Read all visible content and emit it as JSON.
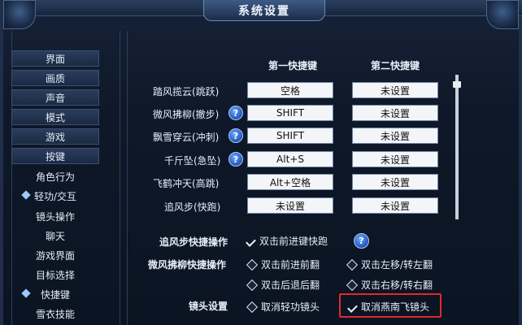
{
  "window": {
    "title": "系统设置"
  },
  "sidebar": {
    "items": [
      {
        "label": "界面",
        "boxed": true,
        "selected": false
      },
      {
        "label": "画质",
        "boxed": true,
        "selected": false
      },
      {
        "label": "声音",
        "boxed": true,
        "selected": false
      },
      {
        "label": "模式",
        "boxed": true,
        "selected": false
      },
      {
        "label": "游戏",
        "boxed": true,
        "selected": false
      },
      {
        "label": "按键",
        "boxed": true,
        "selected": false
      },
      {
        "label": "角色行为",
        "boxed": false,
        "selected": false
      },
      {
        "label": "轻功/交互",
        "boxed": false,
        "selected": true
      },
      {
        "label": "镜头操作",
        "boxed": false,
        "selected": false
      },
      {
        "label": "聊天",
        "boxed": false,
        "selected": false
      },
      {
        "label": "游戏界面",
        "boxed": false,
        "selected": false
      },
      {
        "label": "目标选择",
        "boxed": false,
        "selected": false
      },
      {
        "label": "快捷键",
        "boxed": false,
        "selected": true
      },
      {
        "label": "雪衣技能",
        "boxed": false,
        "selected": false
      }
    ]
  },
  "shortcuts": {
    "col1_header": "第一快捷键",
    "col2_header": "第二快捷键",
    "help_icon_text": "?",
    "rows": [
      {
        "label": "踏风揽云(跳跃)",
        "has_help": false,
        "key1": "空格",
        "key2": "未设置"
      },
      {
        "label": "微风拂柳(撤步)",
        "has_help": true,
        "key1": "SHIFT",
        "key2": "未设置"
      },
      {
        "label": "飘雪穿云(冲刺)",
        "has_help": true,
        "key1": "SHIFT",
        "key2": "未设置"
      },
      {
        "label": "千斤坠(急坠)",
        "has_help": true,
        "key1": "Alt+S",
        "key2": "未设置"
      },
      {
        "label": "飞鹤冲天(高跳)",
        "has_help": false,
        "key1": "Alt+空格",
        "key2": "未设置"
      },
      {
        "label": "追风步(快跑)",
        "has_help": false,
        "key1": "未设置",
        "key2": "未设置"
      }
    ]
  },
  "options": {
    "chase": {
      "label": "追风步快捷操作",
      "option": "双击前进键快跑",
      "checked": true
    },
    "breeze": {
      "label": "微风拂柳快捷操作",
      "opts": [
        {
          "text": "双击前进前翻",
          "checked": false
        },
        {
          "text": "双击左移/转左翻",
          "checked": false
        },
        {
          "text": "双击后退后翻",
          "checked": false
        },
        {
          "text": "双击右移/转右翻",
          "checked": false
        }
      ]
    },
    "camera": {
      "label": "镜头设置",
      "opts": [
        {
          "text": "取消轻功镜头",
          "checked": false
        },
        {
          "text": "取消燕南飞镜头",
          "checked": true
        }
      ]
    }
  },
  "colors": {
    "accent": "#2c62c4",
    "highlight": "#e02a2a"
  }
}
